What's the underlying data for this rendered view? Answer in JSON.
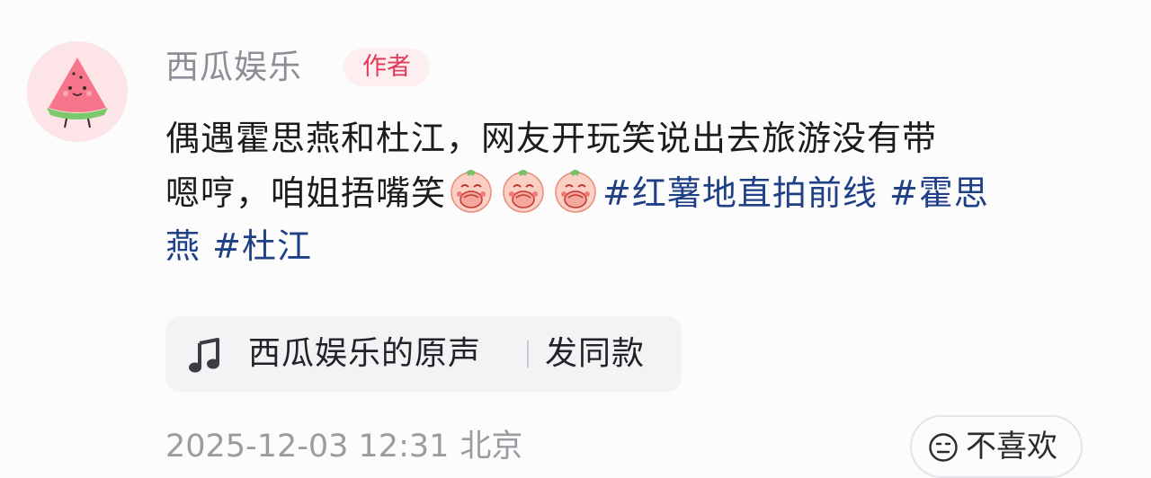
{
  "author": {
    "name": "西瓜娱乐",
    "badge": "作者",
    "avatar_icon": "watermelon-avatar-icon"
  },
  "post": {
    "line1": "偶遇霍思燕和杜江，网友开玩笑说出去旅游没有带",
    "line2_text": "嗯哼，咱姐捂嘴笑",
    "emojis": [
      "covering-mouth-laugh-emoji",
      "covering-mouth-laugh-emoji",
      "covering-mouth-laugh-emoji"
    ],
    "hashtags": [
      "#红薯地直拍前线",
      "#霍思",
      "燕",
      "#杜江"
    ]
  },
  "sound": {
    "icon": "music-note-icon",
    "title": "西瓜娱乐的原声",
    "action": "发同款"
  },
  "meta": {
    "datetime": "2025-12-03 12:31",
    "location": "北京"
  },
  "dislike": {
    "icon": "neutral-face-icon",
    "label": "不喜欢"
  },
  "colors": {
    "hashtag": "#1f3f86",
    "badge_text": "#e23b5a",
    "badge_bg": "#fdeef0",
    "muted_text": "#9a9ca1"
  }
}
